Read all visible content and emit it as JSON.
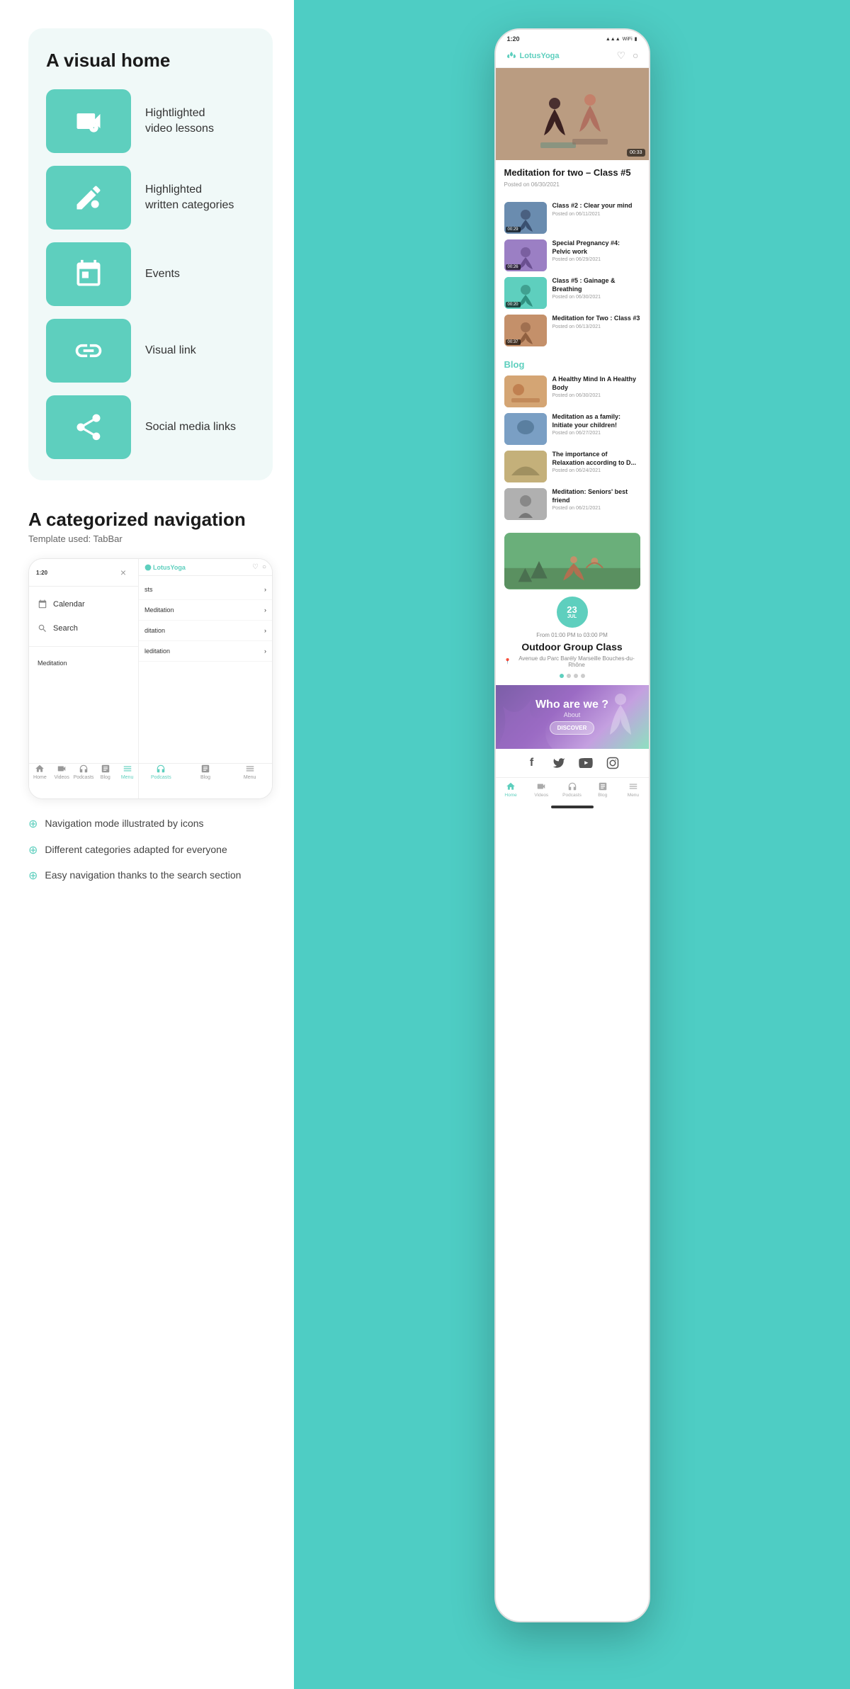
{
  "left": {
    "visual_home": {
      "title": "A visual home",
      "features": [
        {
          "label": "Hightlighted\nvideo lessons",
          "icon": "video"
        },
        {
          "label": "Highlighted\nwritten categories",
          "icon": "pencil"
        },
        {
          "label": "Events",
          "icon": "calendar"
        },
        {
          "label": "Visual link",
          "icon": "link"
        },
        {
          "label": "Social media links",
          "icon": "share"
        }
      ]
    },
    "nav": {
      "title": "A categorized navigation",
      "subtitle": "Template used: TabBar",
      "left_nav": {
        "close": "×",
        "items": [
          "Calendar",
          "Search"
        ]
      },
      "right_nav": {
        "logo": "LotusYoga",
        "items": [
          "sts",
          "Meditation",
          "ditation",
          "leditation"
        ]
      },
      "tabs": [
        "Home",
        "Videos",
        "Podcasts",
        "Blog",
        "Menu"
      ]
    },
    "bullets": [
      "Navigation mode illustrated by icons",
      "Different categories adapted for everyone",
      "Easy navigation thanks to the search section"
    ]
  },
  "right": {
    "app": {
      "logo": "LotusYoga",
      "time": "1:20",
      "hero": {
        "title": "Meditation for two – Class #5",
        "date": "Posted on 06/30/2021",
        "duration": "00:33"
      },
      "videos": [
        {
          "title": "Class #2 : Clear your mind",
          "date": "Posted on 06/11/2021",
          "duration": "00:29"
        },
        {
          "title": "Special Pregnancy #4: Pelvic work",
          "date": "Posted on 06/29/2021",
          "duration": "00:26"
        },
        {
          "title": "Class #5 : Gainage & Breathing",
          "date": "Posted on 06/30/2021",
          "duration": "00:20"
        },
        {
          "title": "Meditation for Two : Class #3",
          "date": "Posted on 06/13/2021",
          "duration": "00:37"
        }
      ],
      "blog": {
        "title": "Blog",
        "items": [
          {
            "title": "A Healthy Mind In A Healthy Body",
            "date": "Posted on 06/30/2021"
          },
          {
            "title": "Meditation as a family: Initiate your children!",
            "date": "Posted on 06/27/2021"
          },
          {
            "title": "The importance of Relaxation according to D...",
            "date": "Posted on 06/24/2021"
          },
          {
            "title": "Meditation: Seniors' best friend",
            "date": "Posted on 06/21/2021"
          }
        ]
      },
      "event": {
        "day": "23",
        "month": "JUL",
        "time": "From 01:00 PM to 03:00 PM",
        "title": "Outdoor Group Class",
        "location": "Avenue du Parc Barély Marseille Bouches-du-Rhône"
      },
      "who_are_we": "Who are we ?",
      "who_about": "About",
      "who_discover": "DISCOVER",
      "social": [
        "f",
        "t",
        "▶",
        "inst"
      ],
      "tabs": [
        "Home",
        "Videos",
        "Podcasts",
        "Blog",
        "Menu"
      ]
    }
  }
}
